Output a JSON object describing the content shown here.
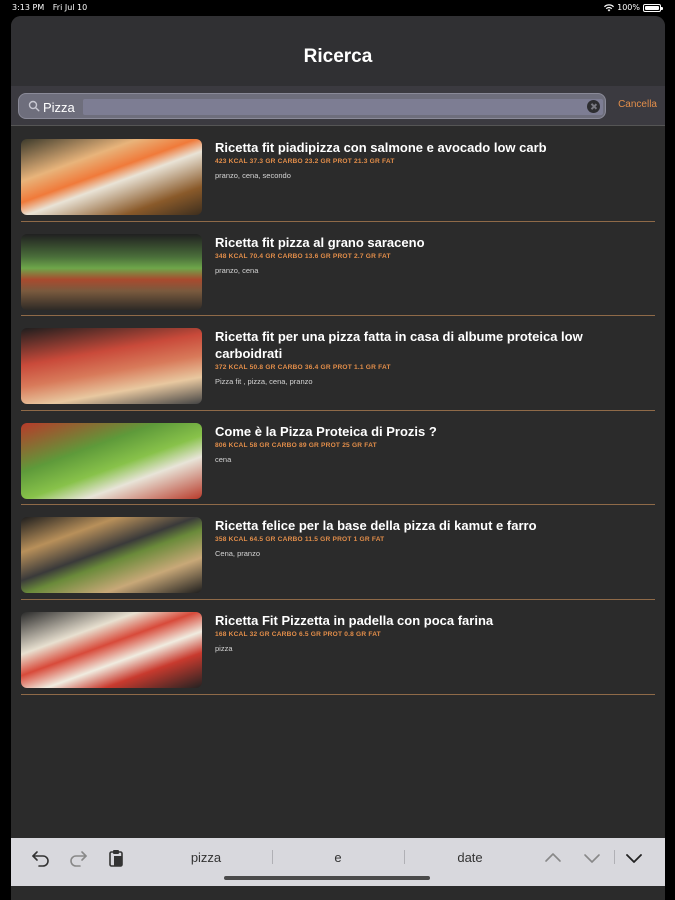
{
  "status": {
    "time": "3:13 PM",
    "date": "Fri Jul 10",
    "battery": "100%"
  },
  "nav": {
    "title": "Ricerca"
  },
  "search": {
    "value": "Pizza",
    "cancel_label": "Cancella"
  },
  "results": [
    {
      "title": "Ricetta fit piadipizza con salmone e avocado low carb",
      "macros": "423 KCAL 37.3 GR CARBO 23.2 GR PROT 21.3 GR FAT",
      "tags": "pranzo, cena, secondo"
    },
    {
      "title": "Ricetta fit pizza al grano saraceno",
      "macros": "348 KCAL 70.4 GR CARBO 13.6 GR PROT 2.7 GR FAT",
      "tags": "pranzo, cena"
    },
    {
      "title": "Ricetta fit per una pizza fatta in casa di albume proteica low carboidrati",
      "macros": "372 KCAL 50.8 GR CARBO 36.4 GR PROT 1.1 GR FAT",
      "tags": "Pizza fit , pizza, cena, pranzo"
    },
    {
      "title": "Come è la Pizza Proteica di Prozis ?",
      "macros": "806 KCAL 58 GR CARBO 89 GR PROT 25 GR FAT",
      "tags": "cena"
    },
    {
      "title": "Ricetta felice per la base della pizza di kamut e farro",
      "macros": "358 KCAL 64.5 GR CARBO 11.5 GR PROT 1 GR FAT",
      "tags": "Cena, pranzo"
    },
    {
      "title": "Ricetta Fit Pizzetta in padella con poca farina",
      "macros": "168 KCAL 32 GR CARBO 6.5 GR PROT 0.8 GR FAT",
      "tags": "pizza"
    }
  ],
  "keyboard_bar": {
    "suggestions": [
      "pizza",
      "e",
      "date"
    ]
  },
  "icons": {
    "undo": "undo-icon",
    "redo": "redo-icon",
    "paste": "paste-icon",
    "prev": "chevron-up-icon",
    "next": "chevron-down-icon",
    "dismiss": "keyboard-dismiss-icon"
  },
  "colors": {
    "accent": "#e38e4a",
    "background": "#2b2b2b",
    "divider": "#8f6a48"
  }
}
